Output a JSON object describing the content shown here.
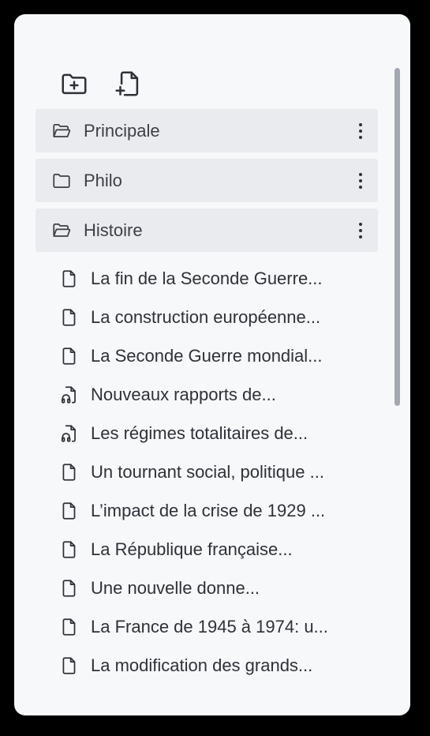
{
  "toolbar": {
    "new_folder_icon": "folder-plus-icon",
    "new_file_icon": "file-plus-icon"
  },
  "folders": [
    {
      "label": "Principale",
      "icon": "folder-open-icon",
      "menu_icon": "kebab-menu-icon"
    },
    {
      "label": "Philo",
      "icon": "folder-icon",
      "menu_icon": "kebab-menu-icon"
    },
    {
      "label": "Histoire",
      "icon": "folder-open-icon",
      "menu_icon": "kebab-menu-icon"
    }
  ],
  "files": [
    {
      "label": "La fin de la Seconde Guerre...",
      "icon": "file-icon"
    },
    {
      "label": "La construction européenne...",
      "icon": "file-icon"
    },
    {
      "label": "La Seconde Guerre mondial...",
      "icon": "file-icon"
    },
    {
      "label": "Nouveaux rapports de...",
      "icon": "audio-file-icon"
    },
    {
      "label": "Les régimes totalitaires de...",
      "icon": "audio-file-icon"
    },
    {
      "label": "Un tournant social, politique ...",
      "icon": "file-icon"
    },
    {
      "label": "L’impact de la crise de 1929 ...",
      "icon": "file-icon"
    },
    {
      "label": "La République française...",
      "icon": "file-icon"
    },
    {
      "label": "Une nouvelle donne...",
      "icon": "file-icon"
    },
    {
      "label": "La France de 1945 à 1974: u...",
      "icon": "file-icon"
    },
    {
      "label": "La modification des grands...",
      "icon": "file-icon"
    }
  ],
  "colors": {
    "background": "#000000",
    "panel": "#f7f8fa",
    "folder_row": "#eaebee",
    "text": "#2f3138",
    "scrollbar": "#a4a8b1"
  }
}
